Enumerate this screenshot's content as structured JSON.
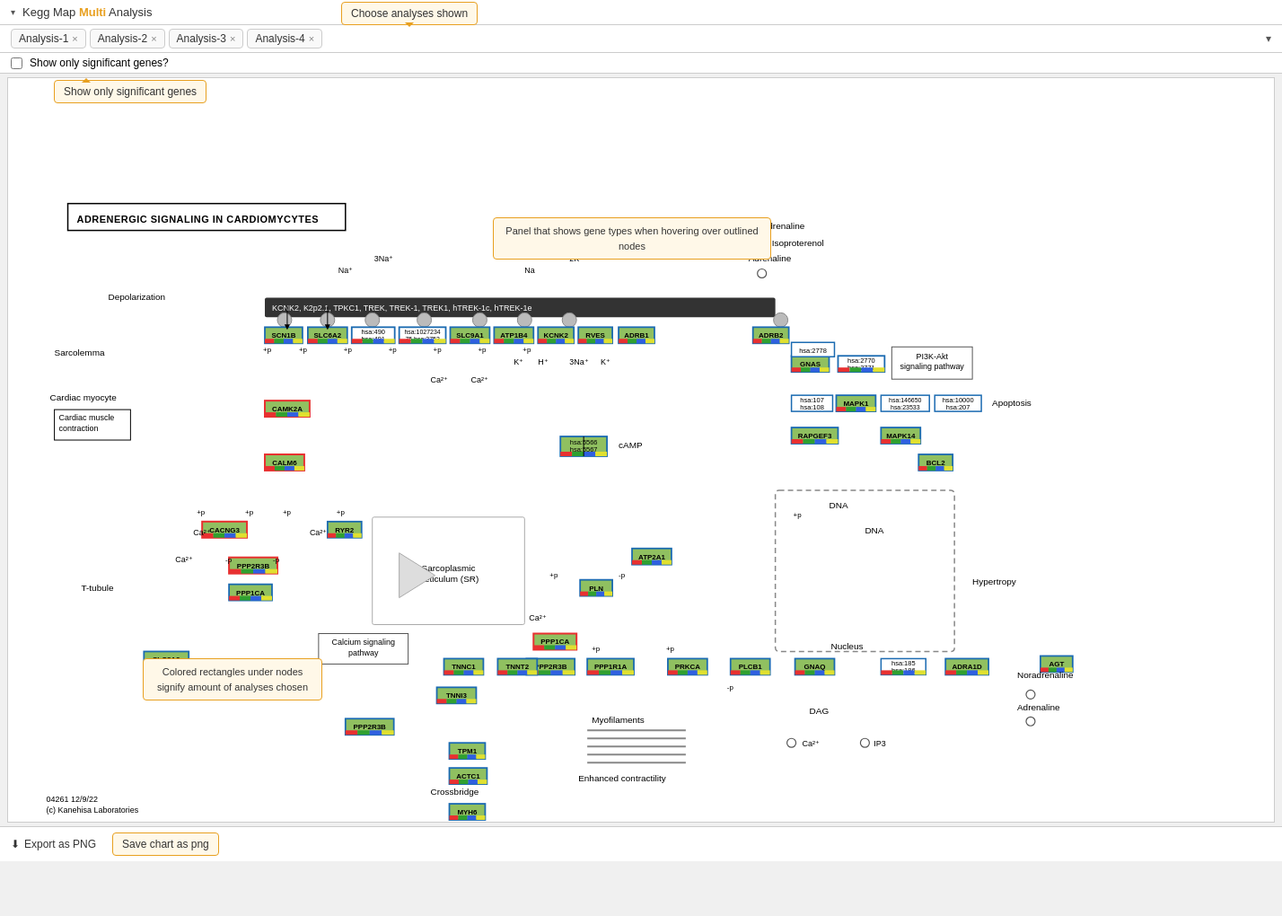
{
  "header": {
    "title": "Kegg Map Multi Analysis",
    "title_highlight": "Multi",
    "chevron": "▾",
    "dropdown_arrow": "▾"
  },
  "tooltip_choose": "Choose analyses shown",
  "tabs": [
    {
      "label": "Analysis-1",
      "closable": true
    },
    {
      "label": "Analysis-2",
      "closable": true
    },
    {
      "label": "Analysis-3",
      "closable": true
    },
    {
      "label": "Analysis-4",
      "closable": true
    }
  ],
  "significant": {
    "label": "Show only significant genes?",
    "button_label": "Show only significant genes"
  },
  "diagram": {
    "title": "ADRENERGIC SIGNALING IN CARDIOMYCYTES",
    "tooltip_gene_types": "Panel that shows gene types when\nhovering over outlined nodes",
    "tooltip_colored_rect": "Colored rectangles under\nnodes signify amount of\nanalyses chosen",
    "dark_bar_label": "KCNK2, K2p2.1, TPKC1, TREK, TREK-1, TREK1, hTREK-1c, hTREK-1e",
    "footer": "04261 12/9/22\n(c) Kanehisa Laboratories",
    "labels": {
      "depolarization": "Depolarization",
      "sarcolemma": "Sarcolemma",
      "cardiac_myocyte": "Cardiac myocyte",
      "cardiac_muscle": "Cardiac muscle\ncontraction",
      "t_tubule": "T-tubule",
      "noradrenaline": "Noradrenaline",
      "isoproterenol": "Isoproterenol",
      "adrenaline": "Adrenaline",
      "cAMP": "cAMP",
      "camp2": "Ca²⁺",
      "sarcoplasmic": "Sarcoplasmic\nReticulum (SR)",
      "calcium_signal": "Calcium signaling\npathway",
      "myofilaments": "Myofilaments",
      "crossbridge": "Crossbridge",
      "enhanced": "Enhanced contractility",
      "dna": "DNA",
      "nucleus": "Nucleus",
      "hypertropy": "Hypertropy",
      "apoptosis": "Apoptosis",
      "pi3k": "PI3K-Akt\nsignaling pathway",
      "dag": "DAG",
      "ip3": "IP3",
      "noradrenaline2": "Noradrenaline",
      "adrenaline2": "Adrenaline"
    }
  },
  "export": {
    "icon": "⬇",
    "label": "Export as PNG"
  },
  "tooltip_save": "Save chart as png",
  "icons": {
    "chevron_down": "▾",
    "close": "×",
    "export": "⬇"
  }
}
